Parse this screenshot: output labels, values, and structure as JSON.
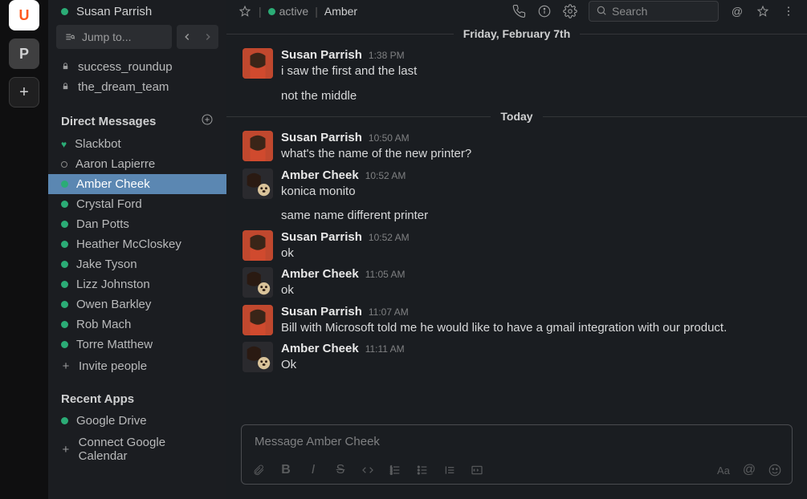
{
  "rail": {
    "workspaces": [
      {
        "letter": "U"
      },
      {
        "letter": "P"
      }
    ]
  },
  "sidebar": {
    "current_user": "Susan Parrish",
    "jump_placeholder": "Jump to...",
    "channels": [
      {
        "name": "success_roundup",
        "private": true
      },
      {
        "name": "the_dream_team",
        "private": true
      }
    ],
    "dm_header": "Direct Messages",
    "dms": [
      {
        "name": "Slackbot",
        "status": "heart"
      },
      {
        "name": "Aaron Lapierre",
        "status": "away"
      },
      {
        "name": "Amber Cheek",
        "status": "active",
        "selected": true
      },
      {
        "name": "Crystal Ford",
        "status": "active"
      },
      {
        "name": "Dan Potts",
        "status": "active"
      },
      {
        "name": "Heather McCloskey",
        "status": "active"
      },
      {
        "name": "Jake Tyson",
        "status": "active"
      },
      {
        "name": "Lizz Johnston",
        "status": "active"
      },
      {
        "name": "Owen Barkley",
        "status": "active"
      },
      {
        "name": "Rob Mach",
        "status": "active"
      },
      {
        "name": "Torre Matthew",
        "status": "active"
      }
    ],
    "invite_label": "Invite people",
    "recent_apps_header": "Recent Apps",
    "recent_apps": [
      {
        "name": "Google Drive",
        "status": "active"
      }
    ],
    "connect_label": "Connect Google Calendar"
  },
  "header": {
    "status_text": "active",
    "name": "Amber",
    "search_placeholder": "Search"
  },
  "dividers": {
    "friday": "Friday, February 7th",
    "today": "Today"
  },
  "messages": [
    {
      "user": "Susan Parrish",
      "avatar": "susan",
      "time": "1:38 PM",
      "text": "i saw the first and the last",
      "cont": [
        "not the middle"
      ]
    },
    {
      "divider": "today"
    },
    {
      "user": "Susan Parrish",
      "avatar": "susan",
      "time": "10:50 AM",
      "text": "what's the name of the new printer?"
    },
    {
      "user": "Amber Cheek",
      "avatar": "amber",
      "time": "10:52 AM",
      "text": "konica monito",
      "cont": [
        "same name different printer"
      ]
    },
    {
      "user": "Susan Parrish",
      "avatar": "susan",
      "time": "10:52 AM",
      "text": "ok"
    },
    {
      "user": "Amber Cheek",
      "avatar": "amber",
      "time": "11:05 AM",
      "text": "ok"
    },
    {
      "user": "Susan Parrish",
      "avatar": "susan",
      "time": "11:07 AM",
      "text": "Bill with Microsoft told me he would like to have a gmail integration with our product."
    },
    {
      "user": "Amber Cheek",
      "avatar": "amber",
      "time": "11:11 AM",
      "text": "Ok"
    }
  ],
  "composer": {
    "placeholder": "Message Amber Cheek"
  }
}
